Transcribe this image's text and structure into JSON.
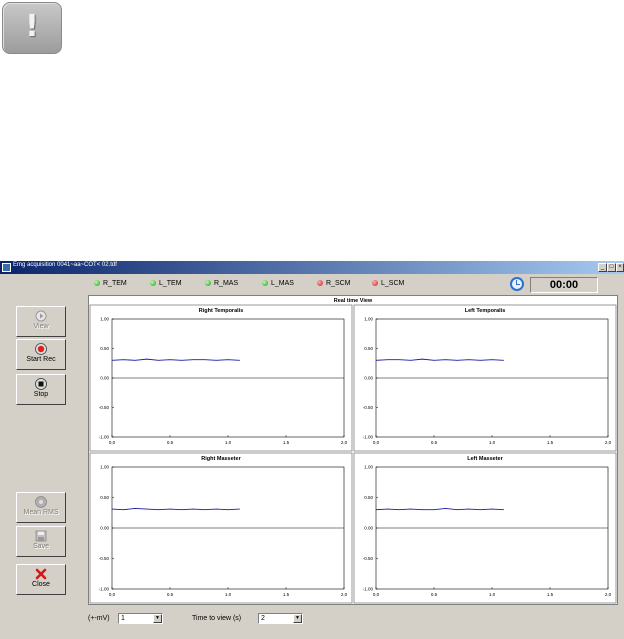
{
  "window": {
    "title": "Emg acquisition 0041~aa~COT< 02.tdf",
    "min_btn": "_",
    "max_btn": "□",
    "close_btn": "×"
  },
  "warning": {
    "glyph": "!"
  },
  "channels": [
    {
      "label": "R_TEM",
      "status": "green"
    },
    {
      "label": "L_TEM",
      "status": "green"
    },
    {
      "label": "R_MAS",
      "status": "green"
    },
    {
      "label": "L_MAS",
      "status": "green"
    },
    {
      "label": "R_SCM",
      "status": "red"
    },
    {
      "label": "L_SCM",
      "status": "red"
    }
  ],
  "timer": "00:00",
  "buttons": {
    "view": "View",
    "start_rec": "Start Rec",
    "stop": "Stop",
    "mean_rms": "Mean RMS",
    "save": "Save",
    "close": "Close"
  },
  "main_title": "Real time View",
  "controls": {
    "scale_label": "(+-mV)",
    "scale_value": "1",
    "time_label": "Time to view (s)",
    "time_value": "2"
  },
  "colors": {
    "trace": "#1a1aa8",
    "accent_red": "#e02020",
    "titlebar": "#0a246a"
  },
  "chart_data": [
    {
      "type": "line",
      "title": "Right Temporalis",
      "xlim": [
        0,
        2
      ],
      "ylim": [
        -1,
        1
      ],
      "xticks": [
        "0.0",
        "0.5",
        "1.0",
        "1.5",
        "2.0"
      ],
      "yticks": [
        "1.00",
        "0.50",
        "0.00",
        "-0.50",
        "-1.00"
      ],
      "series": [
        {
          "x": [
            0.0,
            0.1,
            0.2,
            0.3,
            0.4,
            0.5,
            0.6,
            0.7,
            0.8,
            0.9,
            1.0,
            1.1
          ],
          "values": [
            0.3,
            0.31,
            0.3,
            0.32,
            0.3,
            0.31,
            0.3,
            0.31,
            0.31,
            0.3,
            0.31,
            0.3
          ]
        }
      ]
    },
    {
      "type": "line",
      "title": "Left Temporalis",
      "xlim": [
        0,
        2
      ],
      "ylim": [
        -1,
        1
      ],
      "xticks": [
        "0.0",
        "0.5",
        "1.0",
        "1.5",
        "2.0"
      ],
      "yticks": [
        "1.00",
        "0.50",
        "0.00",
        "-0.50",
        "-1.00"
      ],
      "series": [
        {
          "x": [
            0.0,
            0.1,
            0.2,
            0.3,
            0.4,
            0.5,
            0.6,
            0.7,
            0.8,
            0.9,
            1.0,
            1.1
          ],
          "values": [
            0.3,
            0.31,
            0.31,
            0.3,
            0.32,
            0.3,
            0.31,
            0.3,
            0.31,
            0.3,
            0.31,
            0.3
          ]
        }
      ]
    },
    {
      "type": "line",
      "title": "Right Masseter",
      "xlim": [
        0,
        2
      ],
      "ylim": [
        -1,
        1
      ],
      "xticks": [
        "0.0",
        "0.5",
        "1.0",
        "1.5",
        "2.0"
      ],
      "yticks": [
        "1.00",
        "0.50",
        "0.00",
        "-0.50",
        "-1.00"
      ],
      "series": [
        {
          "x": [
            0.0,
            0.1,
            0.2,
            0.3,
            0.4,
            0.5,
            0.6,
            0.7,
            0.8,
            0.9,
            1.0,
            1.1
          ],
          "values": [
            0.31,
            0.3,
            0.32,
            0.31,
            0.3,
            0.31,
            0.3,
            0.31,
            0.3,
            0.31,
            0.3,
            0.31
          ]
        }
      ]
    },
    {
      "type": "line",
      "title": "Left Masseter",
      "xlim": [
        0,
        2
      ],
      "ylim": [
        -1,
        1
      ],
      "xticks": [
        "0.0",
        "0.5",
        "1.0",
        "1.5",
        "2.0"
      ],
      "yticks": [
        "1.00",
        "0.50",
        "0.00",
        "-0.50",
        "-1.00"
      ],
      "series": [
        {
          "x": [
            0.0,
            0.1,
            0.2,
            0.3,
            0.4,
            0.5,
            0.6,
            0.7,
            0.8,
            0.9,
            1.0,
            1.1
          ],
          "values": [
            0.3,
            0.31,
            0.3,
            0.31,
            0.3,
            0.3,
            0.32,
            0.3,
            0.31,
            0.3,
            0.31,
            0.3
          ]
        }
      ]
    }
  ]
}
